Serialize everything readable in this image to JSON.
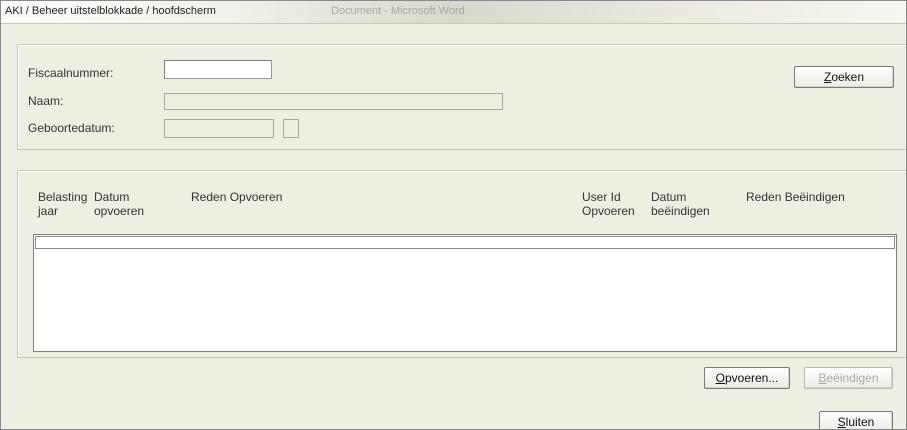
{
  "window": {
    "title": "AKI / Beheer uitstelblokkade / hoofdscherm",
    "background_title": "Document - Microsoft Word"
  },
  "search": {
    "fiscaalnummer_label": "Fiscaalnummer:",
    "fiscaalnummer_value": "",
    "naam_label": "Naam:",
    "naam_value": "",
    "geboortedatum_label": "Geboortedatum:",
    "geboortedatum_value": "",
    "zoeken_label": "Zoeken",
    "zoeken_mnemonic": "Z",
    "zoeken_rest": "oeken"
  },
  "table": {
    "columns": [
      {
        "line1": "Belasting",
        "line2": "jaar"
      },
      {
        "line1": "Datum",
        "line2": "opvoeren"
      },
      {
        "line1": "Reden Opvoeren",
        "line2": ""
      },
      {
        "line1": "User Id",
        "line2": "Opvoeren"
      },
      {
        "line1": "Datum",
        "line2": "beëindigen"
      },
      {
        "line1": "Reden Beëindigen",
        "line2": ""
      }
    ],
    "rows": []
  },
  "actions": {
    "opvoeren_mnemonic": "O",
    "opvoeren_rest": "pvoeren...",
    "beeindigen_mnemonic": "B",
    "beeindigen_rest": "eëindigen",
    "sluiten_mnemonic": "S",
    "sluiten_rest": "luiten"
  }
}
